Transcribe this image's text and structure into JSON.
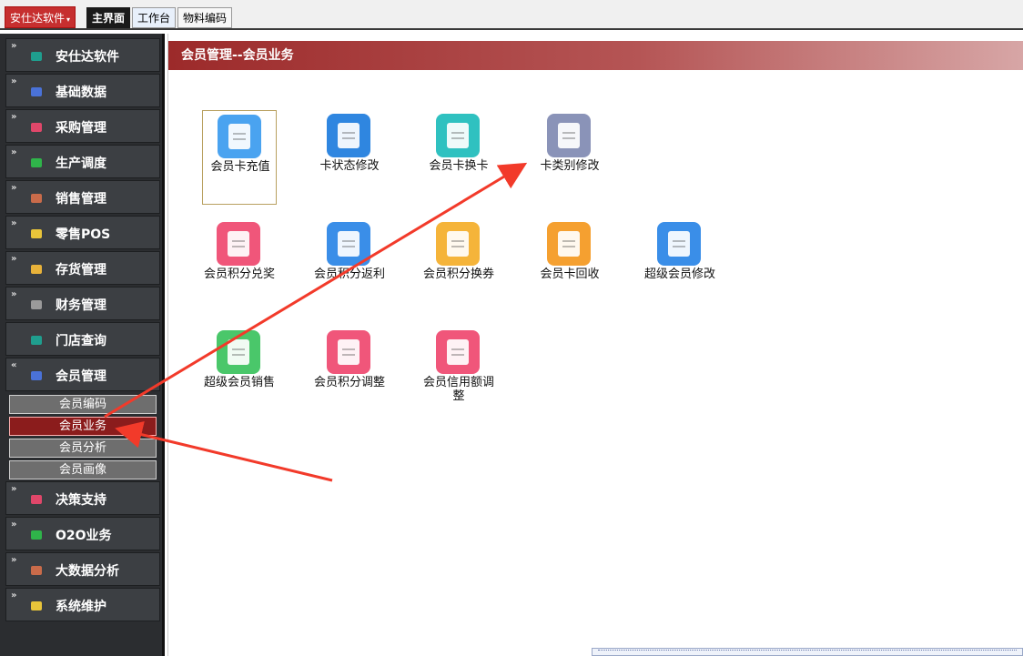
{
  "app_menu": {
    "label": "安仕达软件",
    "caret": "▾"
  },
  "tabs": [
    {
      "label": "主界面"
    },
    {
      "label": "工作台"
    },
    {
      "label": "物料编码"
    }
  ],
  "sidebar": {
    "items": [
      {
        "label": "安仕达软件",
        "icon": "teal-square-icon",
        "color": "#1f9e8e"
      },
      {
        "label": "基础数据",
        "icon": "blue-square-icon",
        "color": "#4a72d8"
      },
      {
        "label": "采购管理",
        "icon": "pink-square-icon",
        "color": "#e0476a"
      },
      {
        "label": "生产调度",
        "icon": "green-square-icon",
        "color": "#2fb44a"
      },
      {
        "label": "销售管理",
        "icon": "brown-square-icon",
        "color": "#c96b4a"
      },
      {
        "label": "零售POS",
        "icon": "yellow-square-icon",
        "color": "#e8c43a"
      },
      {
        "label": "存货管理",
        "icon": "yellow-square-icon",
        "color": "#e8b23a"
      },
      {
        "label": "财务管理",
        "icon": "gray-square-icon",
        "color": "#9a9a9a"
      },
      {
        "label": "门店查询",
        "icon": "teal-square-icon",
        "color": "#1f9e8e"
      },
      {
        "label": "会员管理",
        "icon": "blue-square-icon",
        "color": "#4a72d8"
      },
      {
        "label": "决策支持",
        "icon": "pink-square-icon",
        "color": "#e0476a"
      },
      {
        "label": "O2O业务",
        "icon": "green-square-icon",
        "color": "#2fb44a"
      },
      {
        "label": "大数据分析",
        "icon": "brown-square-icon",
        "color": "#c96b4a"
      },
      {
        "label": "系统维护",
        "icon": "yellow-square-icon",
        "color": "#e8c43a"
      }
    ],
    "chevron_collapsed": "»",
    "chevron_expanded": "«",
    "sub_items": [
      {
        "label": "会员编码"
      },
      {
        "label": "会员业务"
      },
      {
        "label": "会员分析"
      },
      {
        "label": "会员画像"
      }
    ]
  },
  "panel": {
    "title": "会员管理--会员业务",
    "tiles": [
      {
        "label": "会员卡充值",
        "color": "#4aa3f0",
        "icon": "card-recharge-icon"
      },
      {
        "label": "卡状态修改",
        "color": "#2f86e0",
        "icon": "edit-document-icon"
      },
      {
        "label": "会员卡换卡",
        "color": "#2fc1c0",
        "icon": "pin-document-icon"
      },
      {
        "label": "卡类别修改",
        "color": "#8a93b8",
        "icon": "server-stack-icon"
      },
      {
        "label": "会员积分兑奖",
        "color": "#f0567a",
        "icon": "gift-icon"
      },
      {
        "label": "会员积分返利",
        "color": "#3a8ee8",
        "icon": "settings-document-icon"
      },
      {
        "label": "会员积分换券",
        "color": "#f5b43a",
        "icon": "percent-coupon-icon"
      },
      {
        "label": "会员卡回收",
        "color": "#f5a030",
        "icon": "pyramid-icon"
      },
      {
        "label": "超级会员修改",
        "color": "#3a8ee8",
        "icon": "edit-document-icon"
      },
      {
        "label": "超级会员销售",
        "color": "#4ac76a",
        "icon": "upload-folder-icon"
      },
      {
        "label": "会员积分调整",
        "color": "#f0567a",
        "icon": "check-document-icon"
      },
      {
        "label": "会员信用额调整",
        "color": "#f0567a",
        "icon": "user-document-icon"
      }
    ]
  }
}
